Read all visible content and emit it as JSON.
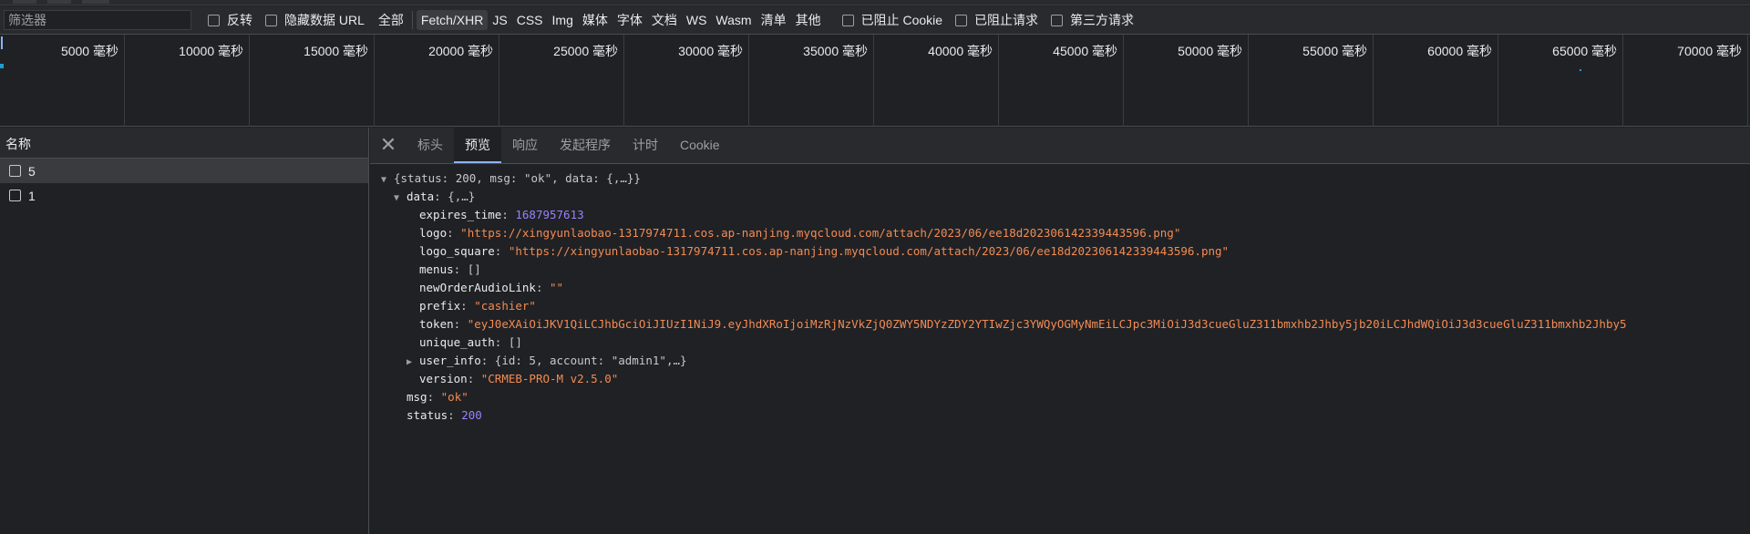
{
  "filterbar": {
    "filter_placeholder": "筛选器",
    "invert_label": "反转",
    "hide_data_url_label": "隐藏数据 URL",
    "types": [
      {
        "label": "全部",
        "active": false
      },
      {
        "label": "Fetch/XHR",
        "active": true
      },
      {
        "label": "JS",
        "active": false
      },
      {
        "label": "CSS",
        "active": false
      },
      {
        "label": "Img",
        "active": false
      },
      {
        "label": "媒体",
        "active": false
      },
      {
        "label": "字体",
        "active": false
      },
      {
        "label": "文档",
        "active": false
      },
      {
        "label": "WS",
        "active": false
      },
      {
        "label": "Wasm",
        "active": false
      },
      {
        "label": "清单",
        "active": false
      },
      {
        "label": "其他",
        "active": false
      }
    ],
    "blocked_cookies_label": "已阻止 Cookie",
    "blocked_requests_label": "已阻止请求",
    "third_party_label": "第三方请求"
  },
  "overview": {
    "ticks": [
      "5000 毫秒",
      "10000 毫秒",
      "15000 毫秒",
      "20000 毫秒",
      "25000 毫秒",
      "30000 毫秒",
      "35000 毫秒",
      "40000 毫秒",
      "45000 毫秒",
      "50000 毫秒",
      "55000 毫秒",
      "60000 毫秒",
      "65000 毫秒",
      "70000 毫秒"
    ]
  },
  "requests": {
    "header": "名称",
    "items": [
      {
        "name": "5",
        "selected": true
      },
      {
        "name": "1",
        "selected": false
      }
    ]
  },
  "detail": {
    "tabs": [
      {
        "label": "标头",
        "active": false
      },
      {
        "label": "预览",
        "active": true
      },
      {
        "label": "响应",
        "active": false
      },
      {
        "label": "发起程序",
        "active": false
      },
      {
        "label": "计时",
        "active": false
      },
      {
        "label": "Cookie",
        "active": false
      }
    ],
    "preview": {
      "root_summary": "{status: 200, msg: \"ok\", data: {,…}}",
      "data_key": "data",
      "data_summary": "{,…}",
      "expires_time": "1687957613",
      "logo": "\"https://xingyunlaobao-1317974711.cos.ap-nanjing.myqcloud.com/attach/2023/06/ee18d202306142339443596.png\"",
      "logo_square": "\"https://xingyunlaobao-1317974711.cos.ap-nanjing.myqcloud.com/attach/2023/06/ee18d202306142339443596.png\"",
      "menus": "[]",
      "newOrderAudioLink": "\"\"",
      "prefix": "\"cashier\"",
      "token": "\"eyJ0eXAiOiJKV1QiLCJhbGciOiJIUzI1NiJ9.eyJhdXRoIjoiMzRjNzVkZjQ0ZWY5NDYzZDY2YTIwZjc3YWQyOGMyNmEiLCJpc3MiOiJ3d3cueGluZ311bmxhb2Jhby5jb20iLCJhdWQiOiJ3d3cueGluZ311bmxhb2Jhby5",
      "unique_auth": "[]",
      "user_info_summary": "{id: 5, account: \"admin1\",…}",
      "version": "\"CRMEB-PRO-M v2.5.0\"",
      "msg": "\"ok\"",
      "status": "200"
    }
  },
  "colors": {
    "background": "#202124",
    "toolbar": "#292a2d",
    "string": "#f28b54",
    "number": "#9980ff",
    "accent": "#8ab4f8"
  },
  "icons": {
    "close": "close-icon",
    "expand": "triangle-down-icon",
    "collapse": "triangle-right-icon"
  }
}
